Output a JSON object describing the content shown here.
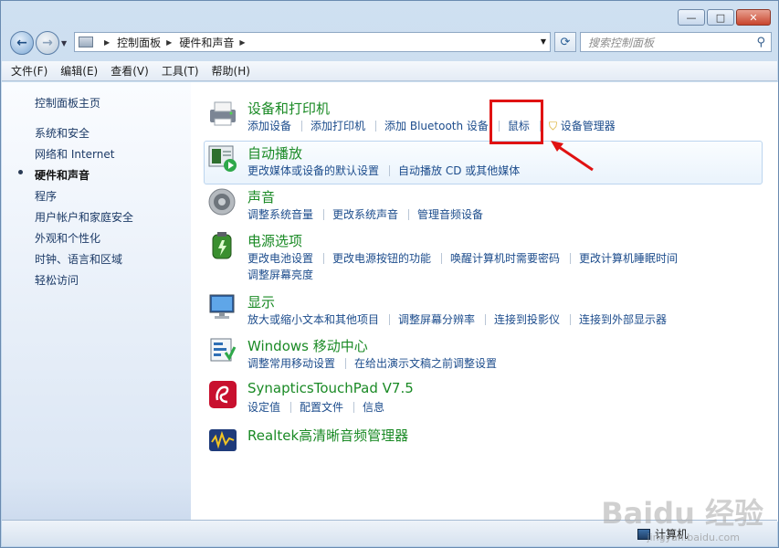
{
  "window": {
    "controls": {
      "minimize": "—",
      "maximize": "□",
      "close": "✕"
    }
  },
  "nav": {
    "back_icon": "←",
    "forward_icon": "→",
    "breadcrumb": [
      "控制面板",
      "硬件和声音"
    ],
    "search_placeholder": "搜索控制面板"
  },
  "menu": [
    "文件(F)",
    "编辑(E)",
    "查看(V)",
    "工具(T)",
    "帮助(H)"
  ],
  "sidebar": {
    "items": [
      {
        "label": "控制面板主页",
        "active": false
      },
      {
        "label": "系统和安全",
        "active": false
      },
      {
        "label": "网络和 Internet",
        "active": false
      },
      {
        "label": "硬件和声音",
        "active": true
      },
      {
        "label": "程序",
        "active": false
      },
      {
        "label": "用户帐户和家庭安全",
        "active": false
      },
      {
        "label": "外观和个性化",
        "active": false
      },
      {
        "label": "时钟、语言和区域",
        "active": false
      },
      {
        "label": "轻松访问",
        "active": false
      }
    ]
  },
  "categories": [
    {
      "title": "设备和打印机",
      "icon": "printer-icon",
      "links": [
        "添加设备",
        "添加打印机",
        "添加 Bluetooth 设备",
        "鼠标",
        "设备管理器"
      ]
    },
    {
      "title": "自动播放",
      "icon": "autoplay-icon",
      "links": [
        "更改媒体或设备的默认设置",
        "自动播放 CD 或其他媒体"
      ]
    },
    {
      "title": "声音",
      "icon": "speaker-icon",
      "links": [
        "调整系统音量",
        "更改系统声音",
        "管理音频设备"
      ]
    },
    {
      "title": "电源选项",
      "icon": "battery-icon",
      "links": [
        "更改电池设置",
        "更改电源按钮的功能",
        "唤醒计算机时需要密码",
        "更改计算机睡眠时间",
        "调整屏幕亮度"
      ]
    },
    {
      "title": "显示",
      "icon": "monitor-icon",
      "links": [
        "放大或缩小文本和其他项目",
        "调整屏幕分辨率",
        "连接到投影仪",
        "连接到外部显示器"
      ]
    },
    {
      "title": "Windows 移动中心",
      "icon": "mobility-center-icon",
      "links": [
        "调整常用移动设置",
        "在给出演示文稿之前调整设置"
      ]
    },
    {
      "title": "SynapticsTouchPad V7.5",
      "icon": "synaptics-icon",
      "links": [
        "设定值",
        "配置文件",
        "信息"
      ]
    },
    {
      "title": "Realtek高清晰音频管理器",
      "icon": "realtek-icon",
      "links": []
    }
  ],
  "status": {
    "computer_label": "计算机"
  },
  "watermark": {
    "text": "Baidu 经验",
    "sub": "jingyan.baidu.com"
  },
  "colors": {
    "category_title": "#1a8a25",
    "link": "#1c4c8c",
    "highlight_box": "#e01212"
  }
}
